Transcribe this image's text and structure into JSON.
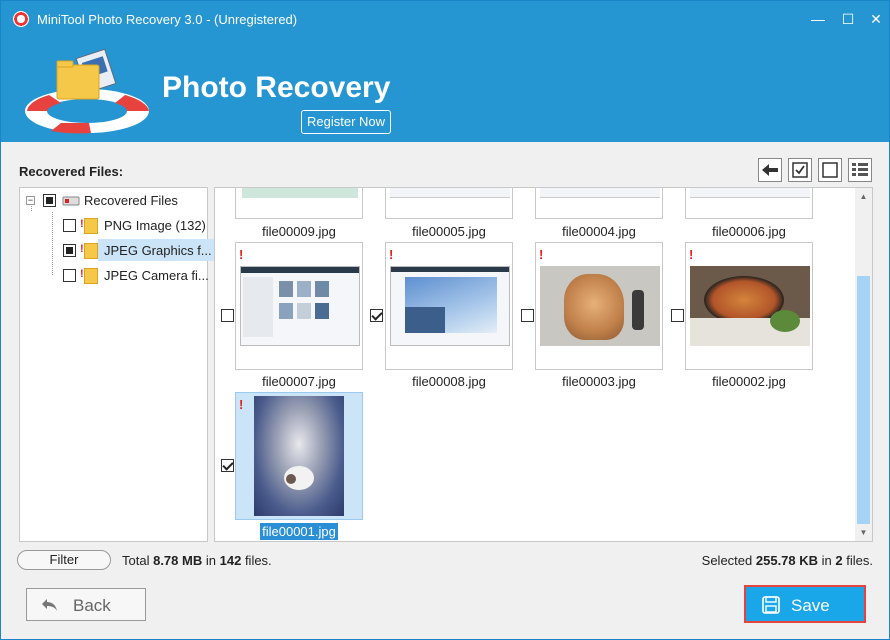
{
  "window": {
    "title": "MiniTool Photo Recovery 3.0 - (Unregistered)",
    "minimize_glyph": "—",
    "maximize_glyph": "☐",
    "close_glyph": "✕"
  },
  "header": {
    "heading": "Photo Recovery",
    "register_label": "Register Now"
  },
  "left": {
    "label": "Recovered Files:",
    "tree": [
      {
        "label": "Recovered Files",
        "check": "partial"
      },
      {
        "label": "PNG Image (132)",
        "check": "unchecked"
      },
      {
        "label": "JPEG Graphics f...",
        "check": "partial",
        "selected": true
      },
      {
        "label": "JPEG Camera fi...",
        "check": "unchecked"
      }
    ]
  },
  "toolbar": {
    "back_icon": "arrow-left-icon",
    "check_all_icon": "check-all-icon",
    "uncheck_all_icon": "uncheck-all-icon",
    "view_icon": "list-view-icon"
  },
  "files": [
    {
      "name": "file00009.jpg",
      "checked": false
    },
    {
      "name": "file00005.jpg",
      "checked": false
    },
    {
      "name": "file00004.jpg",
      "checked": false
    },
    {
      "name": "file00006.jpg",
      "checked": false
    },
    {
      "name": "file00007.jpg",
      "checked": false
    },
    {
      "name": "file00008.jpg",
      "checked": true
    },
    {
      "name": "file00003.jpg",
      "checked": false
    },
    {
      "name": "file00002.jpg",
      "checked": false
    },
    {
      "name": "file00001.jpg",
      "checked": true,
      "selected": true
    }
  ],
  "status": {
    "filter_label": "Filter",
    "total_prefix": "Total",
    "total_size": "8.78 MB",
    "total_in": "in",
    "total_count": "142",
    "total_suffix": "files.",
    "selected_prefix": "Selected",
    "selected_size": "255.78 KB",
    "selected_in": "in",
    "selected_count": "2",
    "selected_suffix": "files."
  },
  "actions": {
    "back_label": "Back",
    "save_label": "Save"
  },
  "colors": {
    "header_bg": "#2596d2",
    "selection": "#cce4f7",
    "save_bg": "#19a7ea",
    "save_border": "#e8423f"
  }
}
